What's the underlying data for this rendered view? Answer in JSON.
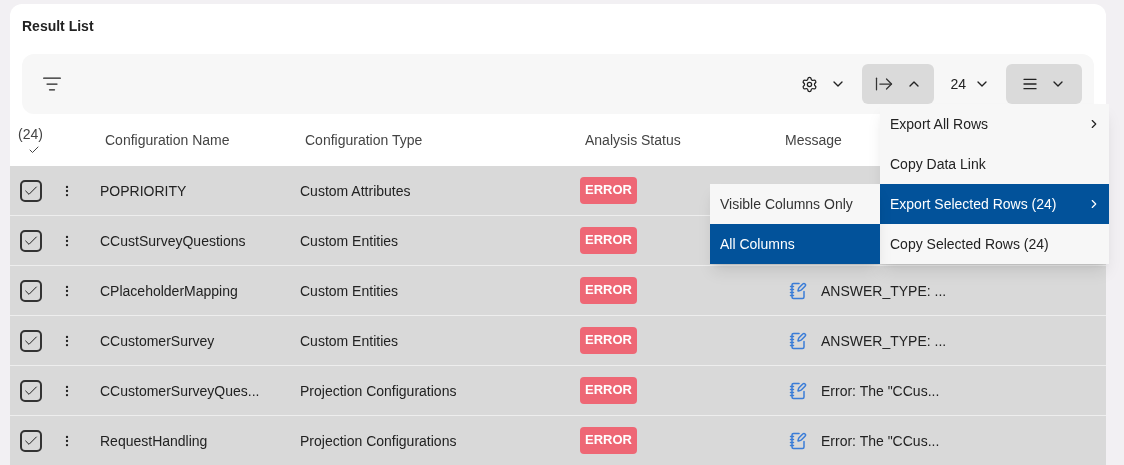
{
  "title": "Result List",
  "toolbar": {
    "page_size": "24",
    "export_open": true
  },
  "header": {
    "selected_count": "(24)",
    "all_checked": true,
    "columns": [
      "Configuration Name",
      "Configuration Type",
      "Analysis Status",
      "Message"
    ]
  },
  "rows": [
    {
      "checked": true,
      "name": "POPRIORITY",
      "type": "Custom Attributes",
      "status": "ERROR"
    },
    {
      "checked": true,
      "name": "CCustSurveyQuestions",
      "type": "Custom Entities",
      "status": "ERROR"
    },
    {
      "checked": true,
      "name": "CPlaceholderMapping",
      "type": "Custom Entities",
      "status": "ERROR",
      "message": "ANSWER_TYPE: ..."
    },
    {
      "checked": true,
      "name": "CCustomerSurvey",
      "type": "Custom Entities",
      "status": "ERROR",
      "message": "ANSWER_TYPE: ..."
    },
    {
      "checked": true,
      "name": "CCustomerSurveyQues...",
      "type": "Projection Configurations",
      "status": "ERROR",
      "message": "Error: The \"CCus..."
    },
    {
      "checked": true,
      "name": "RequestHandling",
      "type": "Projection Configurations",
      "status": "ERROR",
      "message": "Error: The \"CCus..."
    }
  ],
  "export_menu": [
    {
      "label": "Export All Rows",
      "selected": false,
      "submenu": true
    },
    {
      "label": "Copy Data Link",
      "selected": false,
      "submenu": false
    },
    {
      "label": "Export Selected Rows (24)",
      "selected": true,
      "submenu": true
    },
    {
      "label": "Copy Selected Rows (24)",
      "selected": false,
      "submenu": false
    }
  ],
  "submenu": [
    {
      "label": "Visible Columns Only",
      "selected": false
    },
    {
      "label": "All Columns",
      "selected": true
    }
  ]
}
